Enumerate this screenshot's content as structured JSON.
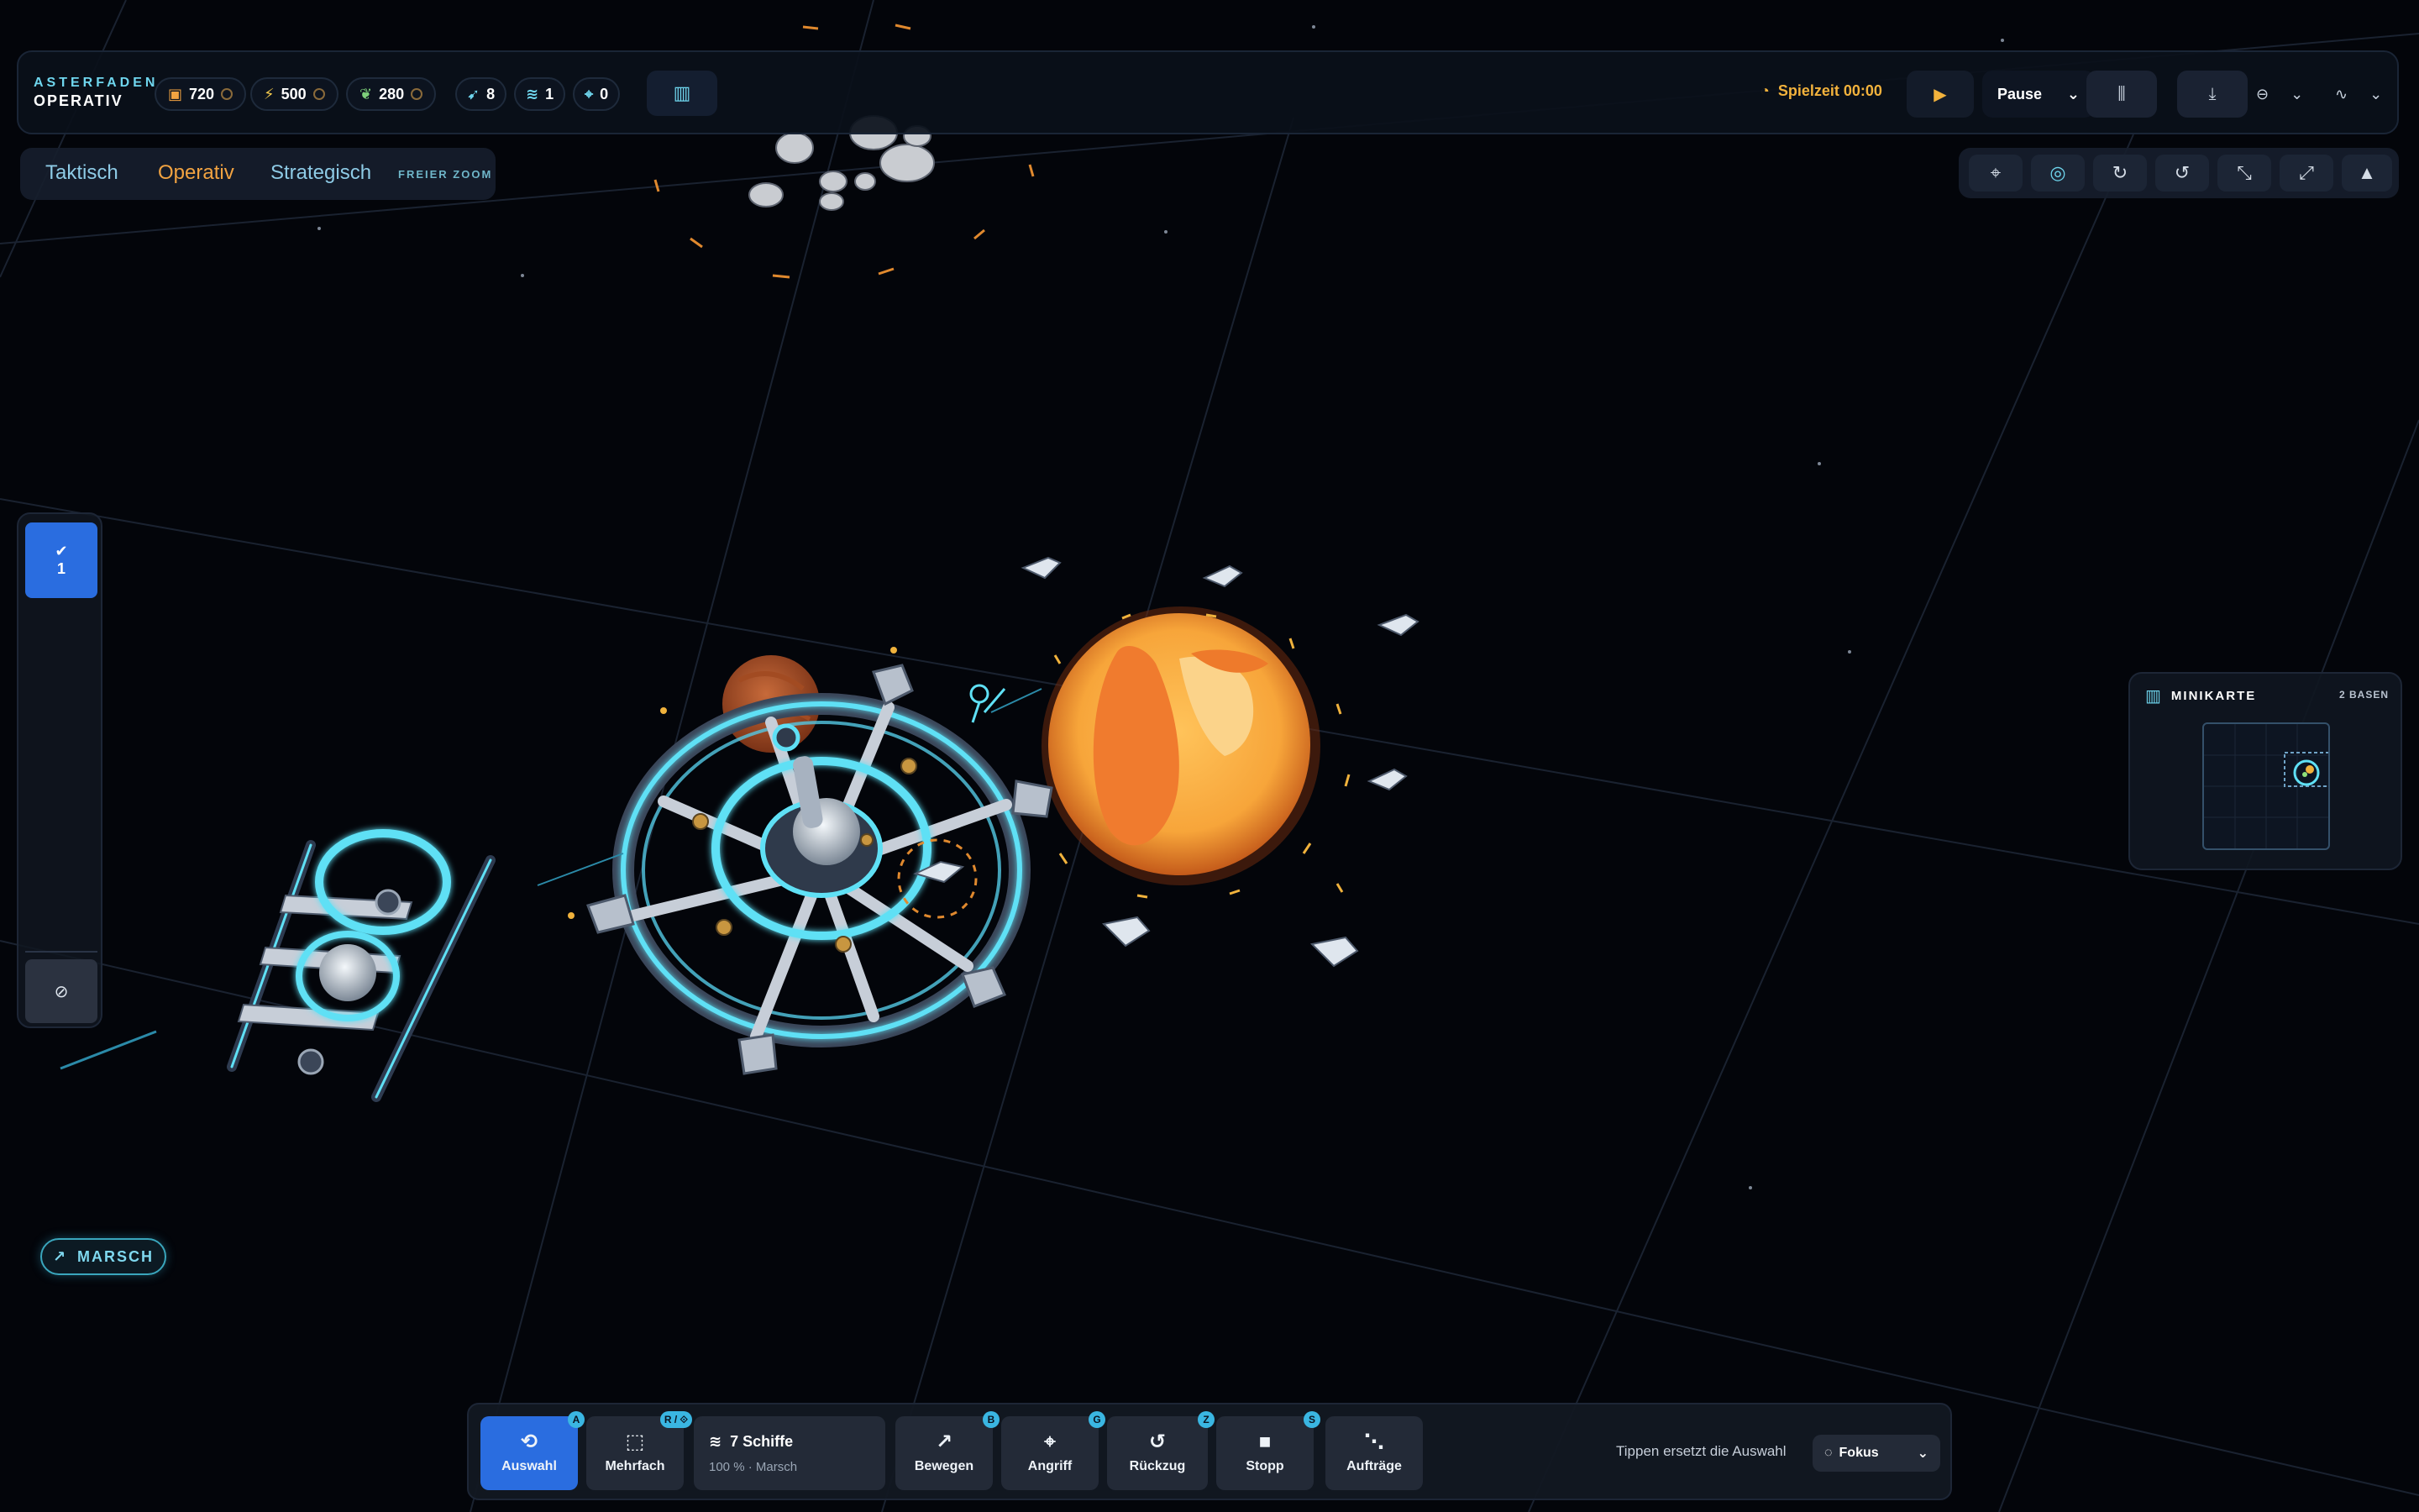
{
  "brand": {
    "line1": "ASTERFADEN",
    "line2": "OPERATIV"
  },
  "resources": [
    {
      "name": "crate",
      "icon": "crate-icon",
      "value": "720",
      "color": "#f2a341"
    },
    {
      "name": "energy",
      "icon": "lightning-icon",
      "value": "500",
      "color": "#f2c94c"
    },
    {
      "name": "biomass",
      "icon": "leaf-icon",
      "value": "280",
      "color": "#7ed07a"
    }
  ],
  "units": [
    {
      "icon": "fleet-icon",
      "value": "8"
    },
    {
      "icon": "layers-icon",
      "value": "1"
    },
    {
      "icon": "target-icon",
      "value": "0"
    }
  ],
  "clock": {
    "label": "Spielzeit 00:00"
  },
  "speed": {
    "label": "Pause"
  },
  "zoom_modes": {
    "tactical": "Taktisch",
    "operative": "Operativ",
    "strategic": "Strategisch",
    "free": "FREIER ZOOM",
    "active": "Operativ"
  },
  "group": {
    "number": "1"
  },
  "march": {
    "label": "MARSCH"
  },
  "minimap": {
    "title": "MINIKARTE",
    "count": "2 BASEN"
  },
  "commands": {
    "select": {
      "label": "Auswahl",
      "key": "A"
    },
    "multi": {
      "label": "Mehrfach",
      "key": "R / ⟐"
    },
    "fleet": {
      "title": "7 Schiffe",
      "sub": "100 % · Marsch"
    },
    "move": {
      "label": "Bewegen",
      "key": "B"
    },
    "attack": {
      "label": "Angriff",
      "key": "G"
    },
    "retreat": {
      "label": "Rückzug",
      "key": "Z"
    },
    "stop": {
      "label": "Stopp",
      "key": "S"
    },
    "orders": {
      "label": "Aufträge"
    }
  },
  "hint": "Tippen ersetzt die Auswahl",
  "focus": {
    "label": "Fokus"
  },
  "colors": {
    "accent": "#3ab6e2",
    "active_blue": "#2a6de0",
    "amber": "#f2b23c",
    "sun": "#f5a53a"
  }
}
